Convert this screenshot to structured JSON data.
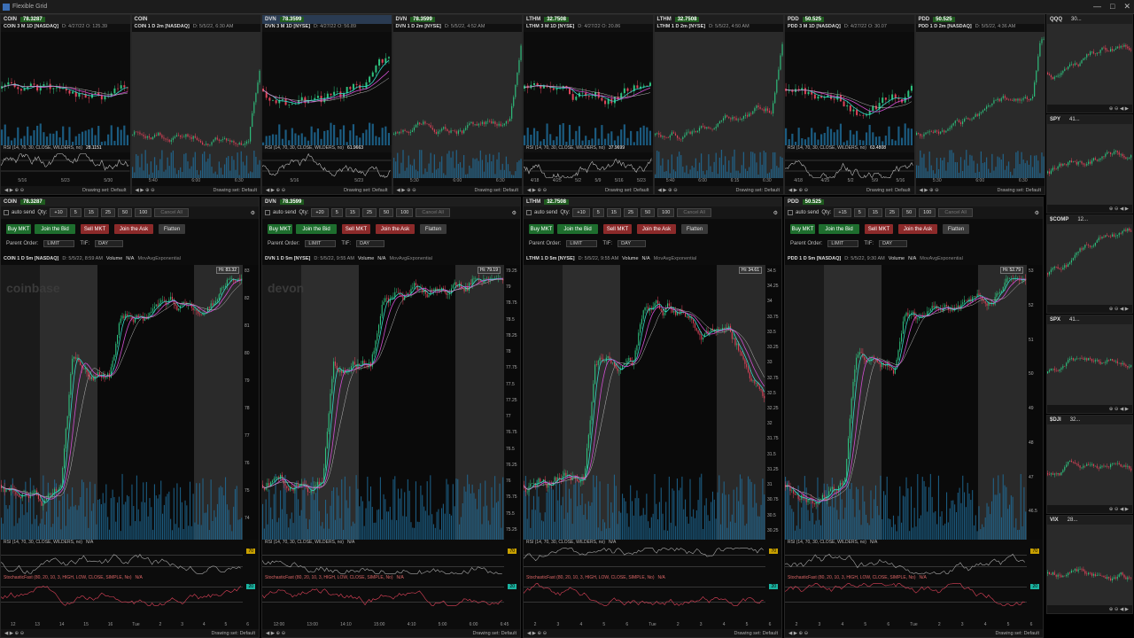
{
  "window": {
    "title": "Flexible Grid"
  },
  "top_charts": [
    {
      "ticker": "COIN",
      "price": "78.3287",
      "title": "COIN 3 M 1D [NASDAQ]",
      "info": "D: 4/27/22 O: 125.39",
      "rsi": "RSI (14, 70, 30, CLOSE, WILDERS, no)",
      "rsi_val": "28.1151",
      "x_labels": [
        "5/16",
        "5/23",
        "5/30"
      ],
      "drawing": "Drawing set: Default",
      "dark_bg": false
    },
    {
      "ticker": "COIN",
      "price": "",
      "title": "COIN 1 D 2m [NASDAQ]",
      "info": "D: 5/5/22, 6:30 AM",
      "rsi": "",
      "rsi_val": "",
      "x_labels": [
        "5:40",
        "6:00",
        "6:30"
      ],
      "drawing": "Drawing set: Default",
      "dark_bg": true
    },
    {
      "ticker": "DVN",
      "price": "78.3599",
      "title": "DVN 3 M 1D [NYSE]",
      "info": "D: 4/27/22 O: 56.89",
      "rsi": "RSI (14, 70, 30, CLOSE, WILDERS, no)",
      "rsi_val": "61.9663",
      "x_labels": [
        "5/16",
        "5/23"
      ],
      "drawing": "Drawing set: Default",
      "dark_bg": false
    },
    {
      "ticker": "DVN",
      "price": "78.3599",
      "title": "DVN 1 D 2m [NYSE]",
      "info": "D: 5/5/22, 4:52 AM",
      "rsi": "",
      "rsi_val": "",
      "x_labels": [
        "5:30",
        "6:00",
        "6:30"
      ],
      "drawing": "Drawing set: Default",
      "dark_bg": true
    },
    {
      "ticker": "LTHM",
      "price": "32.7508",
      "title": "LTHM 3 M 1D [NYSE]",
      "info": "D: 4/27/22 O: 20.86",
      "rsi": "RSI (14, 70, 30, CLOSE, WILDERS, no)",
      "rsi_val": "37.9699",
      "x_labels": [
        "4/18",
        "4/25",
        "5/2",
        "5/9",
        "5/16",
        "5/23"
      ],
      "drawing": "Drawing set: Default",
      "dark_bg": false
    },
    {
      "ticker": "LTHM",
      "price": "32.7508",
      "title": "LTHM 1 D 2m [NYSE]",
      "info": "D: 5/5/22, 4:50 AM",
      "rsi": "",
      "rsi_val": "",
      "x_labels": [
        "5:40",
        "6:00",
        "6:15",
        "6:30"
      ],
      "drawing": "Drawing set: Default",
      "dark_bg": true
    },
    {
      "ticker": "PDD",
      "price": "50.525",
      "title": "PDD 3 M 1D [NASDAQ]",
      "info": "D: 4/27/22 O: 30.07",
      "rsi": "RSI (14, 70, 30, CLOSE, WILDERS, no)",
      "rsi_val": "63.4808",
      "x_labels": [
        "4/18",
        "4/25",
        "5/2",
        "5/9",
        "5/16"
      ],
      "drawing": "Drawing set: Default",
      "dark_bg": false
    },
    {
      "ticker": "PDD",
      "price": "50.525",
      "title": "PDD 1 D 2m [NASDAQ]",
      "info": "D: 5/5/22, 4:36 AM",
      "rsi": "",
      "rsi_val": "",
      "x_labels": [
        "5:30",
        "6:00",
        "6:30"
      ],
      "drawing": "Drawing set: Default",
      "dark_bg": true
    }
  ],
  "trade_panels": [
    {
      "ticker": "COIN",
      "price": "78.3287",
      "qty": "+10",
      "chart_title": "COIN 1 D 5m [NASDAQ]",
      "chart_info": "D: 5/5/22, 8:59 AM",
      "watermark": "coinbase",
      "hi": "Hi: 83.32",
      "y_labels": [
        "83",
        "82",
        "81",
        "80",
        "79",
        "78",
        "77",
        "76",
        "75",
        "74"
      ],
      "x_labels": [
        "12",
        "13",
        "14",
        "15",
        "16",
        "Tue",
        "2",
        "3",
        "4",
        "5",
        "6"
      ],
      "rsi_val": "70",
      "stoch_val": "20"
    },
    {
      "ticker": "DVN",
      "price": "78.3599",
      "qty": "+20",
      "chart_title": "DVN 1 D 5m [NYSE]",
      "chart_info": "D: 5/5/22, 9:55 AM",
      "watermark": "devon",
      "hi": "Hi: 79.19",
      "y_labels": [
        "79.25",
        "79",
        "78.75",
        "78.5",
        "78.25",
        "78",
        "77.75",
        "77.5",
        "77.25",
        "77",
        "76.75",
        "76.5",
        "76.25",
        "76",
        "75.75",
        "75.5",
        "75.25"
      ],
      "x_labels": [
        "12:00",
        "13:00",
        "14:10",
        "15:00",
        "4:10",
        "5:00",
        "6:00",
        "6:45"
      ],
      "rsi_val": "70",
      "stoch_val": "20"
    },
    {
      "ticker": "LTHM",
      "price": "32.7508",
      "qty": "+10",
      "chart_title": "LTHM 1 D 5m [NYSE]",
      "chart_info": "D: 5/5/22, 9:55 AM",
      "watermark": "",
      "hi": "Hi: 34.61",
      "y_labels": [
        "34.5",
        "34.25",
        "34",
        "33.75",
        "33.5",
        "33.25",
        "33",
        "32.75",
        "32.5",
        "32.25",
        "32",
        "31.75",
        "31.5",
        "31.25",
        "31",
        "30.75",
        "30.5",
        "30.25"
      ],
      "x_labels": [
        "2",
        "3",
        "4",
        "5",
        "6",
        "Tue",
        "2",
        "3",
        "4",
        "5",
        "6"
      ],
      "rsi_val": "70",
      "stoch_val": "20"
    },
    {
      "ticker": "PDD",
      "price": "50.525",
      "qty": "+15",
      "chart_title": "PDD 1 D 5m [NASDAQ]",
      "chart_info": "D: 5/5/22, 9:30 AM",
      "watermark": "",
      "hi": "Hi: 52.79",
      "y_labels": [
        "53",
        "52",
        "51",
        "50",
        "49",
        "48",
        "47",
        "46.5"
      ],
      "x_labels": [
        "2",
        "3",
        "4",
        "5",
        "6",
        "Tue",
        "2",
        "3",
        "4",
        "5",
        "6"
      ],
      "rsi_val": "70",
      "stoch_val": "20"
    }
  ],
  "trade_common": {
    "auto_send": "auto send",
    "qty_label": "Qty:",
    "qty_buttons": [
      "5",
      "15",
      "25",
      "50",
      "100"
    ],
    "cancel_all": "Cancel All",
    "buy_mkt": "Buy MKT",
    "join_bid": "Join the Bid",
    "sell_mkt": "Sell MKT",
    "join_ask": "Join the Ask",
    "flatten": "Flatten",
    "parent_order": "Parent Order:",
    "order_type": "LIMIT",
    "tif_label": "TIF:",
    "tif": "DAY",
    "volume": "Volume",
    "na": "N/A",
    "mavg": "MovAvgExponential",
    "rsi": "RSI (14, 70, 30, CLOSE, WILDERS, no)",
    "stoch": "StochasticFast (80, 20, 10, 3, HIGH, LOW, CLOSE, SIMPLE, No)",
    "drawing": "Drawing set: Default"
  },
  "side_charts": [
    {
      "ticker": "QQQ",
      "price": "30..."
    },
    {
      "ticker": "SPY",
      "price": "41..."
    },
    {
      "ticker": "$COMP",
      "price": "12..."
    },
    {
      "ticker": "SPX",
      "price": "41..."
    },
    {
      "ticker": "$DJI",
      "price": "32..."
    },
    {
      "ticker": "VIX",
      "price": "28..."
    }
  ],
  "colors": {
    "up": "#2ec27e",
    "down": "#e0435a",
    "ma_cyan": "#34d8c8",
    "ma_pink": "#d34fd3",
    "volume": "#1f6f9e"
  }
}
